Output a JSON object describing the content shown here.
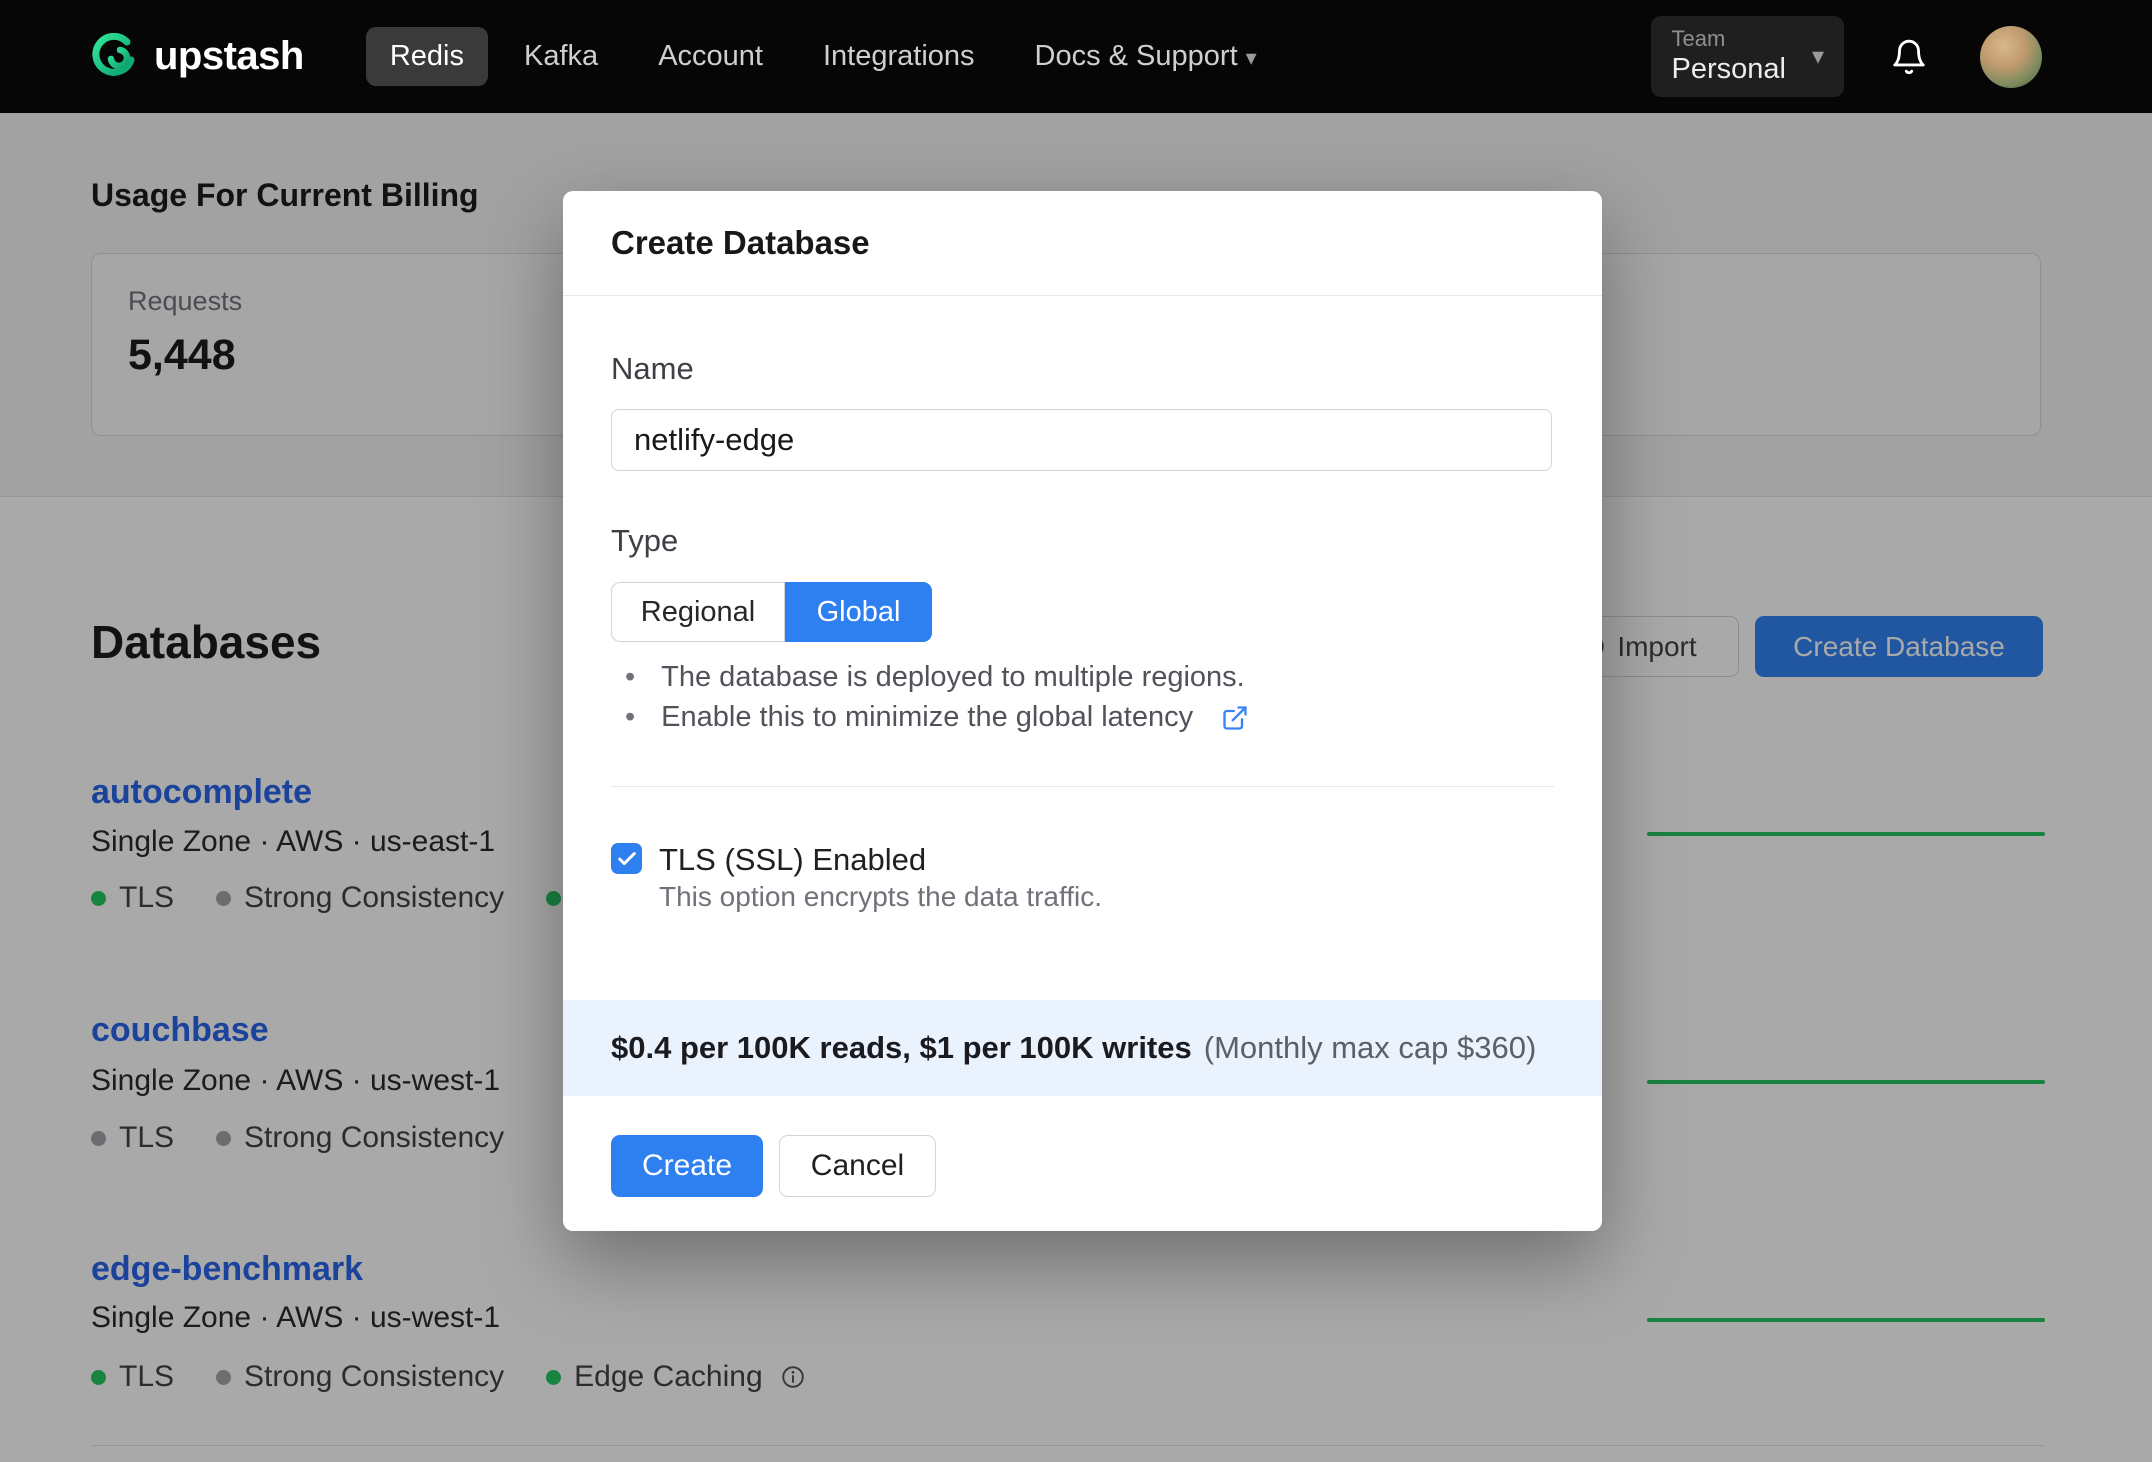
{
  "nav": {
    "brand": "upstash",
    "items": [
      {
        "label": "Redis",
        "active": true
      },
      {
        "label": "Kafka",
        "active": false
      },
      {
        "label": "Account",
        "active": false
      },
      {
        "label": "Integrations",
        "active": false
      },
      {
        "label": "Docs & Support",
        "active": false,
        "has_caret": true
      }
    ],
    "team": {
      "label": "Team",
      "value": "Personal"
    }
  },
  "billing": {
    "heading": "Usage For Current Billing",
    "requests_label": "Requests",
    "requests_value": "5,448"
  },
  "databases": {
    "heading": "Databases",
    "import_label": "Import",
    "create_label": "Create Database",
    "rows": [
      {
        "name": "autocomplete",
        "meta": "Single Zone · AWS · us-east-1",
        "badges": [
          {
            "label": "TLS",
            "color": "green"
          },
          {
            "label": "Strong Consistency",
            "color": "gray"
          },
          {
            "label": "",
            "color": "green"
          }
        ]
      },
      {
        "name": "couchbase",
        "meta": "Single Zone · AWS · us-west-1",
        "badges": [
          {
            "label": "TLS",
            "color": "gray"
          },
          {
            "label": "Strong Consistency",
            "color": "gray"
          }
        ]
      },
      {
        "name": "edge-benchmark",
        "meta": "Single Zone · AWS · us-west-1",
        "badges": [
          {
            "label": "TLS",
            "color": "green"
          },
          {
            "label": "Strong Consistency",
            "color": "gray"
          },
          {
            "label": "Edge Caching",
            "color": "green",
            "has_info": true
          }
        ]
      }
    ]
  },
  "modal": {
    "title": "Create Database",
    "name_label": "Name",
    "name_value": "netlify-edge",
    "type_label": "Type",
    "type_regional": "Regional",
    "type_global": "Global",
    "type_selected": "Global",
    "bullet_1": "The database is deployed to multiple regions.",
    "bullet_2": "Enable this to minimize the global latency",
    "tls_label": "TLS (SSL) Enabled",
    "tls_checked": true,
    "tls_help": "This option encrypts the data traffic.",
    "pricing_main": "$0.4 per 100K reads, $1 per 100K writes",
    "pricing_note": "(Monthly max cap $360)",
    "create_label": "Create",
    "cancel_label": "Cancel"
  },
  "colors": {
    "accent_blue": "#2e80f1",
    "green": "#22c55e",
    "link_blue": "#2563eb",
    "nav_bg": "#060606",
    "pricing_band_bg": "#eaf2fe"
  }
}
